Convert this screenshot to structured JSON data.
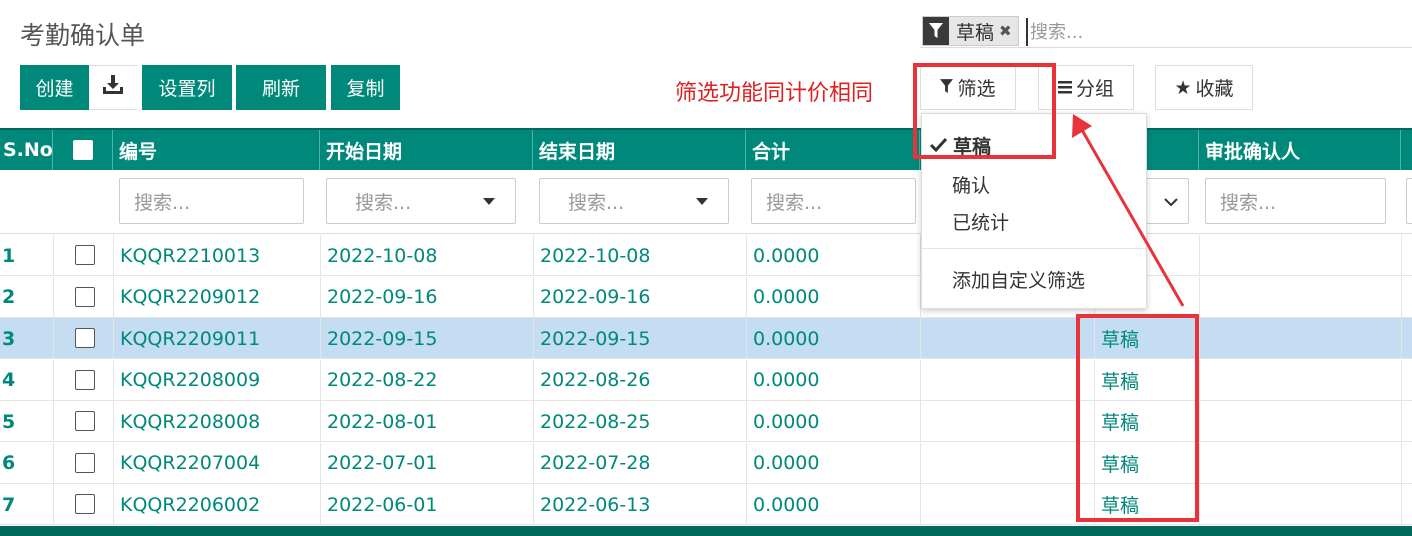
{
  "page_title": "考勤确认单",
  "search": {
    "facet_label": "草稿",
    "placeholder": "搜索..."
  },
  "toolbar": {
    "create_label": "创建",
    "set_columns_label": "设置列",
    "refresh_label": "刷新",
    "copy_label": "复制",
    "filter_label": "筛选",
    "group_label": "分组",
    "favorite_label": "收藏"
  },
  "annotation": "筛选功能同计价相同",
  "columns": {
    "sno": "S.No",
    "code": "编号",
    "start_date": "开始日期",
    "end_date": "结束日期",
    "total": "合计",
    "approver": "审批确认人"
  },
  "filter_placeholders": {
    "code": "搜索...",
    "start_date": "搜索...",
    "end_date": "搜索...",
    "total": "搜索...",
    "approver": "搜索..."
  },
  "filter_menu": {
    "items": [
      "草稿",
      "确认",
      "已统计"
    ],
    "custom": "添加自定义筛选"
  },
  "rows": [
    {
      "sno": "1",
      "code": "KQQR2210013",
      "start": "2022-10-08",
      "end": "2022-10-08",
      "total": "0.0000",
      "status": ""
    },
    {
      "sno": "2",
      "code": "KQQR2209012",
      "start": "2022-09-16",
      "end": "2022-09-16",
      "total": "0.0000",
      "status": ""
    },
    {
      "sno": "3",
      "code": "KQQR2209011",
      "start": "2022-09-15",
      "end": "2022-09-15",
      "total": "0.0000",
      "status": "草稿"
    },
    {
      "sno": "4",
      "code": "KQQR2208009",
      "start": "2022-08-22",
      "end": "2022-08-26",
      "total": "0.0000",
      "status": "草稿"
    },
    {
      "sno": "5",
      "code": "KQQR2208008",
      "start": "2022-08-01",
      "end": "2022-08-25",
      "total": "0.0000",
      "status": "草稿"
    },
    {
      "sno": "6",
      "code": "KQQR2207004",
      "start": "2022-07-01",
      "end": "2022-07-28",
      "total": "0.0000",
      "status": "草稿"
    },
    {
      "sno": "7",
      "code": "KQQR2206002",
      "start": "2022-06-01",
      "end": "2022-06-13",
      "total": "0.0000",
      "status": "草稿"
    }
  ],
  "colors": {
    "primary": "#00897b",
    "selected_row": "#c4ddf2",
    "annotation": "#e8333b"
  }
}
